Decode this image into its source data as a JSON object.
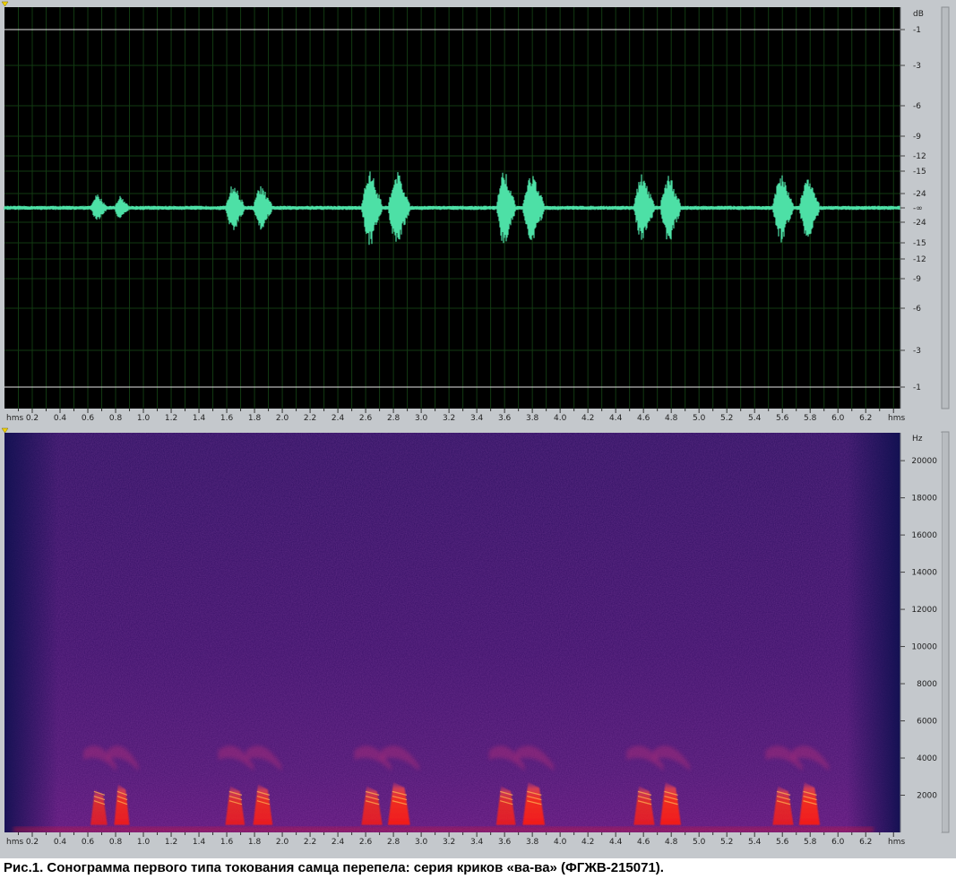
{
  "caption": "Рис.1. Сонограмма первого типа токования самца перепела: серия криков «ва-ва» (ФГЖВ-215071).",
  "colors": {
    "wave": "#4de0a6",
    "wave_bg": "#000000",
    "grid": "#123a12",
    "clip_line": "#e6e6e6",
    "panel_bg": "#c4c8cc",
    "marker": "#f2d200",
    "spec_base": "#3a1068",
    "spec_hot": "#ff2a10"
  },
  "time_axis": {
    "unit_label": "hms",
    "ticks": [
      "0.2",
      "0.4",
      "0.6",
      "0.8",
      "1.0",
      "1.2",
      "1.4",
      "1.6",
      "1.8",
      "2.0",
      "2.2",
      "2.4",
      "2.6",
      "2.8",
      "3.0",
      "3.2",
      "3.4",
      "3.6",
      "3.8",
      "4.0",
      "4.2",
      "4.4",
      "4.6",
      "4.8",
      "5.0",
      "5.2",
      "5.4",
      "5.6",
      "5.8",
      "6.0",
      "6.2"
    ],
    "range": [
      0,
      6.45
    ]
  },
  "chart_data": [
    {
      "type": "line",
      "xlabel": "hms",
      "ylabel": "dB",
      "grid": true,
      "xlim": [
        0,
        6.45
      ],
      "y_scale": "dB (symmetric, -∞ at center)",
      "y_ticks_upper": [
        "-1",
        "-3",
        "-6",
        "-9",
        "-12",
        "-15",
        "-24",
        "-∞"
      ],
      "y_ticks_lower": [
        "-24",
        "-15",
        "-12",
        "-9",
        "-6",
        "-3",
        "-1"
      ],
      "noise_floor_amplitude": 0.012,
      "calls": [
        {
          "start": 0.62,
          "end": 0.74,
          "peak_amplitude": 0.08
        },
        {
          "start": 0.79,
          "end": 0.9,
          "peak_amplitude": 0.07
        },
        {
          "start": 1.59,
          "end": 1.73,
          "peak_amplitude": 0.14
        },
        {
          "start": 1.79,
          "end": 1.93,
          "peak_amplitude": 0.13
        },
        {
          "start": 2.57,
          "end": 2.72,
          "peak_amplitude": 0.22
        },
        {
          "start": 2.76,
          "end": 2.92,
          "peak_amplitude": 0.22
        },
        {
          "start": 3.54,
          "end": 3.68,
          "peak_amplitude": 0.22
        },
        {
          "start": 3.73,
          "end": 3.89,
          "peak_amplitude": 0.2
        },
        {
          "start": 4.53,
          "end": 4.68,
          "peak_amplitude": 0.2
        },
        {
          "start": 4.72,
          "end": 4.87,
          "peak_amplitude": 0.2
        },
        {
          "start": 5.53,
          "end": 5.68,
          "peak_amplitude": 0.2
        },
        {
          "start": 5.72,
          "end": 5.87,
          "peak_amplitude": 0.18
        }
      ]
    },
    {
      "type": "heatmap",
      "xlabel": "hms",
      "ylabel": "Hz",
      "xlim": [
        0,
        6.45
      ],
      "ylim": [
        0,
        21500
      ],
      "y_ticks": [
        "2000",
        "4000",
        "6000",
        "8000",
        "10000",
        "12000",
        "14000",
        "16000",
        "18000",
        "20000"
      ],
      "y_tick_values": [
        2000,
        4000,
        6000,
        8000,
        10000,
        12000,
        14000,
        16000,
        18000,
        20000
      ],
      "background": "low-energy noise (purple)",
      "energy_bands": [
        {
          "start": 0.62,
          "end": 0.74,
          "freq_low": 400,
          "freq_high": 2300,
          "intensity": 0.75
        },
        {
          "start": 0.79,
          "end": 0.9,
          "freq_low": 400,
          "freq_high": 2600,
          "intensity": 0.85
        },
        {
          "start": 1.59,
          "end": 1.73,
          "freq_low": 400,
          "freq_high": 2500,
          "intensity": 0.8
        },
        {
          "start": 1.79,
          "end": 1.93,
          "freq_low": 400,
          "freq_high": 2600,
          "intensity": 0.85
        },
        {
          "start": 2.57,
          "end": 2.72,
          "freq_low": 400,
          "freq_high": 2500,
          "intensity": 0.8
        },
        {
          "start": 2.76,
          "end": 2.92,
          "freq_low": 400,
          "freq_high": 2700,
          "intensity": 0.9
        },
        {
          "start": 3.54,
          "end": 3.68,
          "freq_low": 400,
          "freq_high": 2500,
          "intensity": 0.8
        },
        {
          "start": 3.73,
          "end": 3.89,
          "freq_low": 400,
          "freq_high": 2700,
          "intensity": 0.9
        },
        {
          "start": 4.53,
          "end": 4.68,
          "freq_low": 400,
          "freq_high": 2500,
          "intensity": 0.8
        },
        {
          "start": 4.72,
          "end": 4.87,
          "freq_low": 400,
          "freq_high": 2700,
          "intensity": 0.9
        },
        {
          "start": 5.53,
          "end": 5.68,
          "freq_low": 400,
          "freq_high": 2500,
          "intensity": 0.8
        },
        {
          "start": 5.72,
          "end": 5.87,
          "freq_low": 400,
          "freq_high": 2700,
          "intensity": 0.9
        }
      ],
      "low_band": {
        "freq_low": 0,
        "freq_high": 300,
        "intensity": 0.7
      }
    }
  ]
}
